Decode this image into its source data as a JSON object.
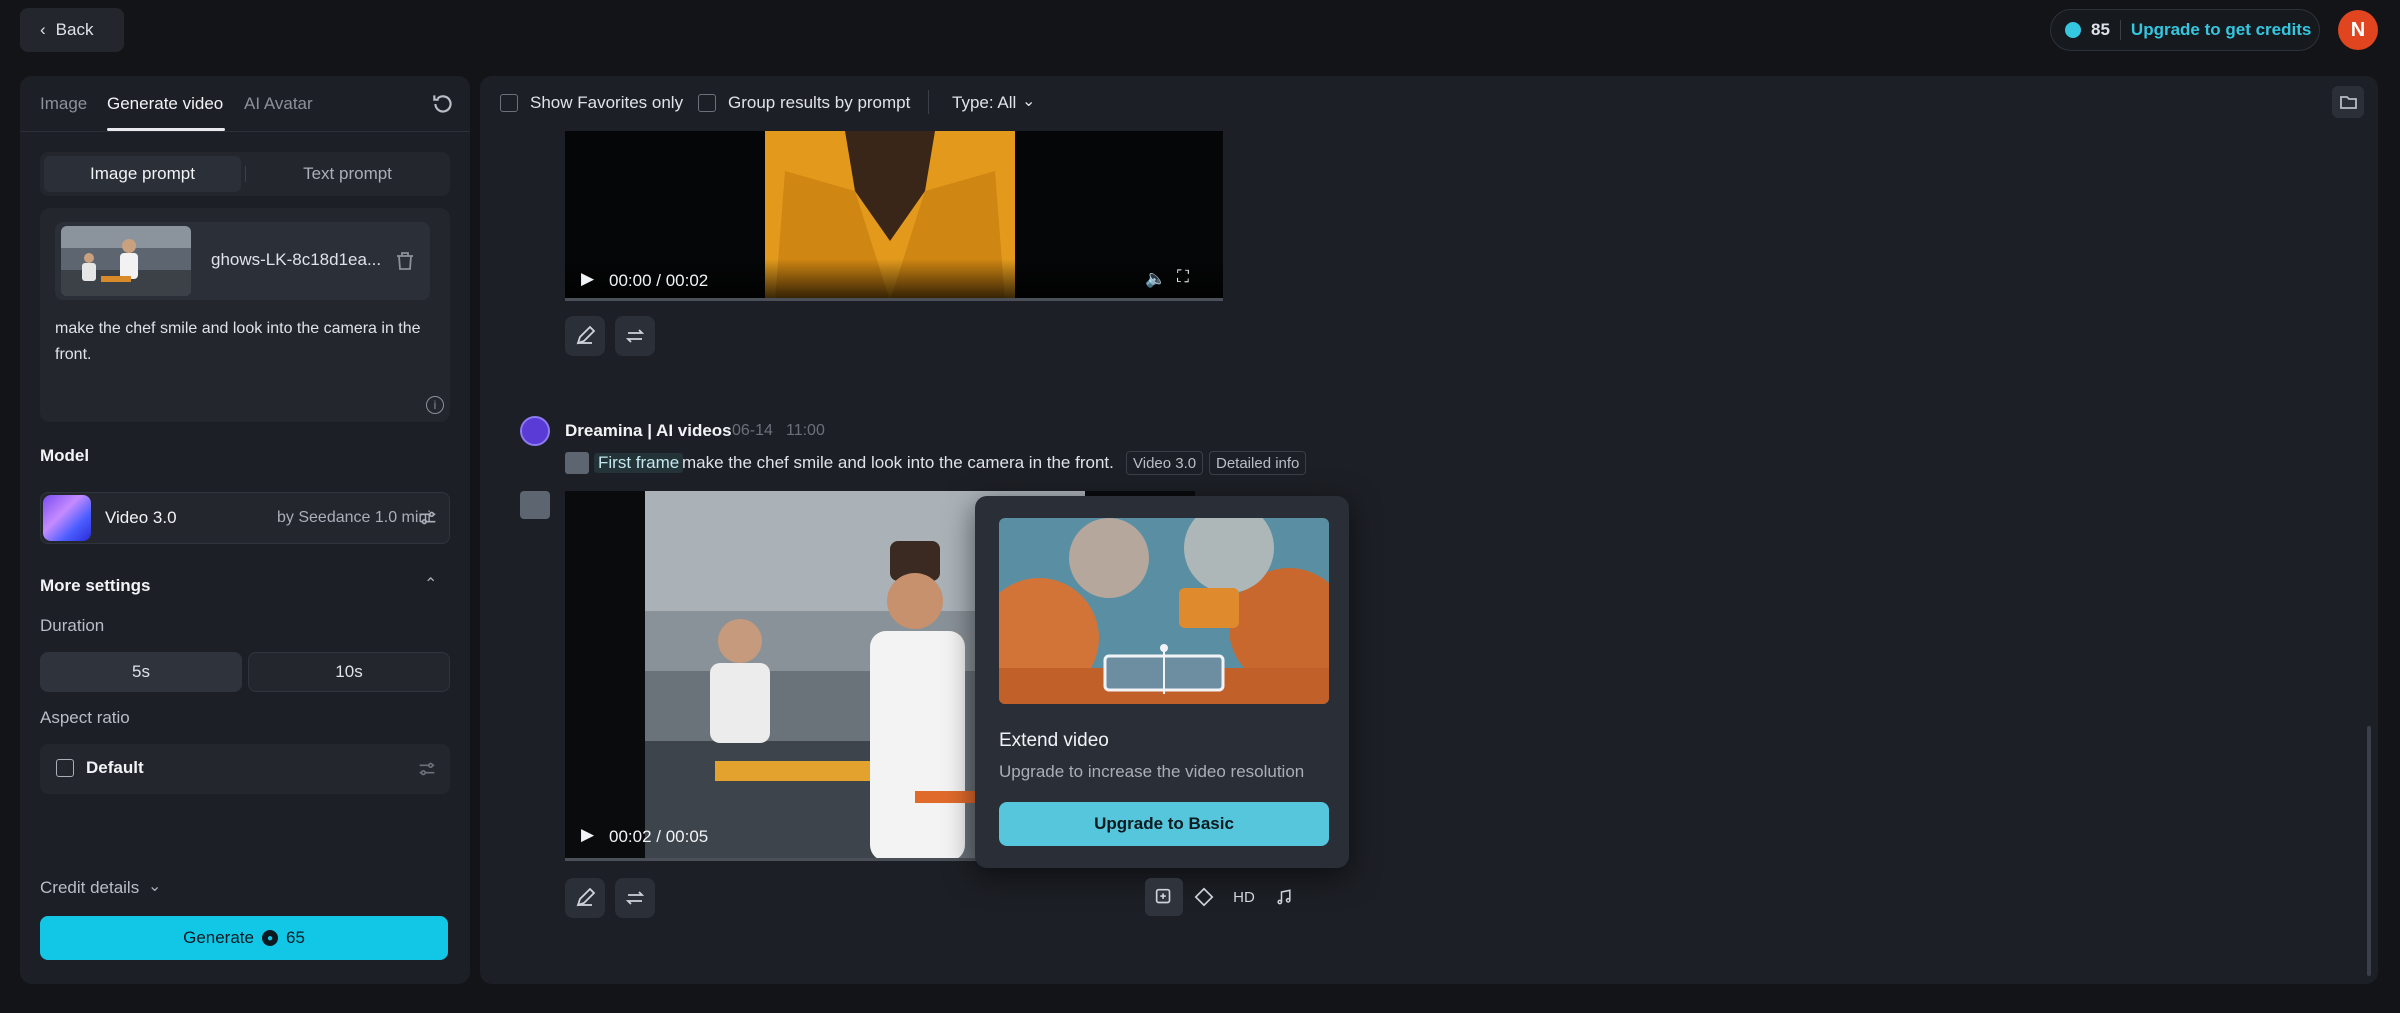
{
  "topbar": {
    "back_label": "Back",
    "credits": "85",
    "upgrade_label": "Upgrade to get credits",
    "avatar_initial": "N"
  },
  "left": {
    "tabs": [
      {
        "label": "Image"
      },
      {
        "label": "Generate video",
        "active": true
      },
      {
        "label": "AI Avatar"
      }
    ],
    "prompt_modes": [
      "Image prompt",
      "Text prompt"
    ],
    "file_name": "ghows-LK-8c18d1ea...",
    "prompt_text": "make the chef smile and look into the camera in the front.",
    "model_heading": "Model",
    "model_name": "Video 3.0",
    "model_by": "by Seedance 1.0 mini",
    "more_settings": "More settings",
    "duration_label": "Duration",
    "durations": [
      "5s",
      "10s"
    ],
    "aspect_label": "Aspect ratio",
    "aspect_value": "Default",
    "credit_details": "Credit details",
    "generate_label": "Generate",
    "generate_cost": "65"
  },
  "main": {
    "filters": {
      "favorites": "Show Favorites only",
      "group": "Group results by prompt",
      "type": "Type: All"
    },
    "video1": {
      "time": "00:00 / 00:02"
    },
    "entry": {
      "author": "Dreamina | AI videos",
      "date": "06-14",
      "time": "11:00",
      "first_frame": "First frame",
      "prompt": "make the chef smile and look into the camera in the front.",
      "tag_model": "Video 3.0",
      "tag_info": "Detailed info"
    },
    "video2": {
      "time": "00:02 / 00:05"
    },
    "popup": {
      "title": "Extend video",
      "subtitle": "Upgrade to increase the video resolution",
      "button": "Upgrade to Basic"
    },
    "tools": {
      "hd": "HD"
    }
  },
  "colors": {
    "accent": "#12c6e6",
    "avatar": "#e0451f",
    "popup_button": "#55c6dc"
  }
}
